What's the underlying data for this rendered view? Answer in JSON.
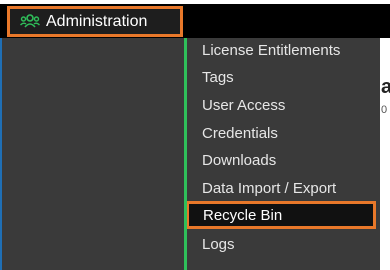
{
  "header": {
    "admin_label": "Administration",
    "admin_icon": "users-icon",
    "accent_color": "#2fbf5a",
    "highlight_color": "#e8782a"
  },
  "submenu": {
    "items": [
      {
        "label": "License Entitlements"
      },
      {
        "label": "Tags"
      },
      {
        "label": "User Access"
      },
      {
        "label": "Credentials"
      },
      {
        "label": "Downloads"
      },
      {
        "label": "Data Import / Export"
      },
      {
        "label": "Recycle Bin",
        "selected": true
      },
      {
        "label": "Logs"
      }
    ]
  },
  "background": {
    "partial_heading": "a",
    "partial_text": "0"
  }
}
